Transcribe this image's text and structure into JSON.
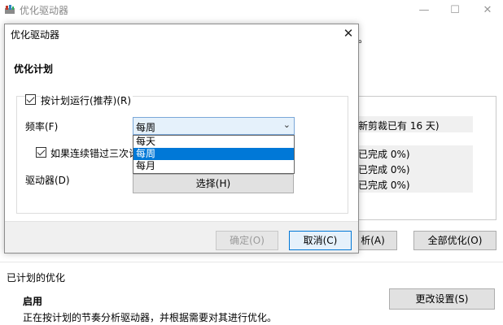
{
  "background_window": {
    "title": "优化驱动器",
    "top_fragment": "。",
    "list_rows": [
      "新剪裁已有 16 天)",
      "已完成 0%)",
      "已完成 0%)",
      "已完成 0%)"
    ],
    "analyze_button": "析(A)",
    "optimize_all_button": "全部优化(O)",
    "scheduled_heading": "已计划的优化",
    "status": "启用",
    "status_description": "正在按计划的节奏分析驱动器，并根据需要对其进行优化。",
    "change_settings_button": "更改设置(S)"
  },
  "dialog": {
    "title": "优化驱动器",
    "close_glyph": "✕",
    "section_title": "优化计划",
    "schedule_checkbox_label": "按计划运行(推荐)(R)",
    "frequency_label": "频率(F)",
    "frequency_value": "每周",
    "frequency_options": [
      "每天",
      "每周",
      "每月"
    ],
    "selected_option": "每周",
    "missed_checkbox_label": "如果连续错过三次计划",
    "drives_label": "驱动器(D)",
    "choose_button": "选择(H)",
    "ok_button": "确定(O)",
    "cancel_button": "取消(C)"
  },
  "icons": {
    "app": "defrag-drive-icon",
    "minimize": "minimize-icon",
    "maximize": "maximize-icon",
    "close": "close-icon",
    "dropdown": "chevron-down-icon",
    "checkbox": "checkmark-icon"
  },
  "colors": {
    "selection": "#0078d7",
    "select_background": "#e5f1fb",
    "footer_background": "#f0f0f0"
  }
}
